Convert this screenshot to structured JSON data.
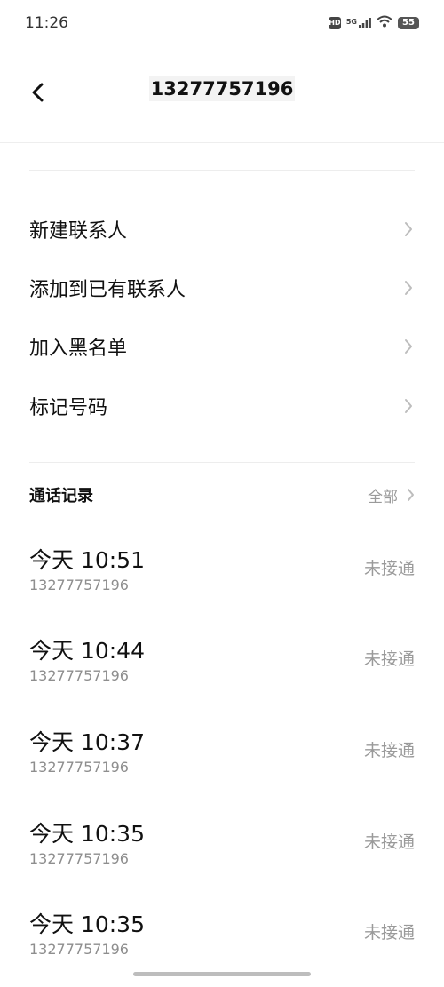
{
  "status_bar": {
    "time": "11:26",
    "hd": "HD",
    "network": "5G",
    "battery": "55"
  },
  "header": {
    "title": "13277757196"
  },
  "menu": {
    "items": [
      {
        "label": "新建联系人"
      },
      {
        "label": "添加到已有联系人"
      },
      {
        "label": "加入黑名单"
      },
      {
        "label": "标记号码"
      }
    ]
  },
  "call_log": {
    "title": "通话记录",
    "all_label": "全部",
    "entries": [
      {
        "time": "今天 10:51",
        "number": "13277757196",
        "status": "未接通"
      },
      {
        "time": "今天 10:44",
        "number": "13277757196",
        "status": "未接通"
      },
      {
        "time": "今天 10:37",
        "number": "13277757196",
        "status": "未接通"
      },
      {
        "time": "今天 10:35",
        "number": "13277757196",
        "status": "未接通"
      },
      {
        "time": "今天 10:35",
        "number": "13277757196",
        "status": "未接通"
      }
    ]
  },
  "colors": {
    "text": "#111111",
    "secondary": "#8e8e8e",
    "divider": "#ededed"
  }
}
